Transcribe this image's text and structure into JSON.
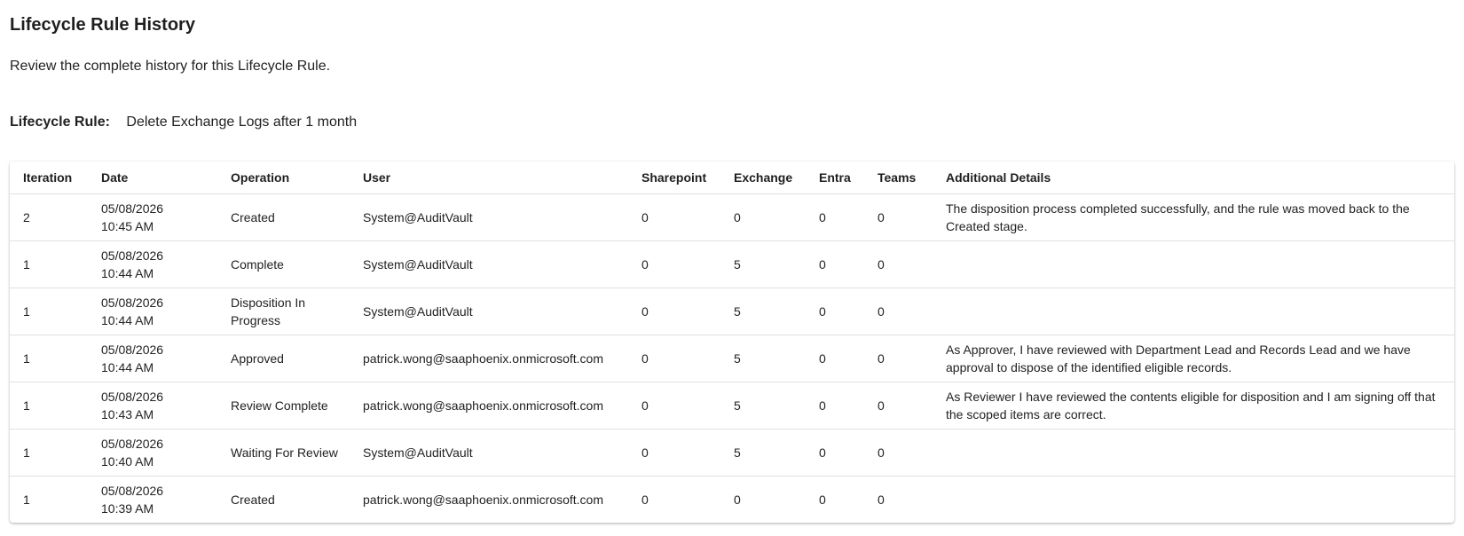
{
  "page": {
    "title": "Lifecycle Rule History",
    "subtitle": "Review the complete history for this Lifecycle Rule.",
    "rule_label": "Lifecycle Rule:",
    "rule_name": "Delete Exchange Logs after 1 month"
  },
  "table": {
    "headers": [
      "Iteration",
      "Date",
      "Operation",
      "User",
      "Sharepoint",
      "Exchange",
      "Entra",
      "Teams",
      "Additional Details"
    ],
    "rows": [
      {
        "iteration": "2",
        "date": "05/08/2026",
        "time": "10:45 AM",
        "operation": "Created",
        "user": "System@AuditVault",
        "sharepoint": "0",
        "exchange": "0",
        "entra": "0",
        "teams": "0",
        "details": "The disposition process completed successfully, and the rule was moved back to the Created stage."
      },
      {
        "iteration": "1",
        "date": "05/08/2026",
        "time": "10:44 AM",
        "operation": "Complete",
        "user": "System@AuditVault",
        "sharepoint": "0",
        "exchange": "5",
        "entra": "0",
        "teams": "0",
        "details": ""
      },
      {
        "iteration": "1",
        "date": "05/08/2026",
        "time": "10:44 AM",
        "operation": "Disposition In Progress",
        "user": "System@AuditVault",
        "sharepoint": "0",
        "exchange": "5",
        "entra": "0",
        "teams": "0",
        "details": ""
      },
      {
        "iteration": "1",
        "date": "05/08/2026",
        "time": "10:44 AM",
        "operation": "Approved",
        "user": "patrick.wong@saaphoenix.onmicrosoft.com",
        "sharepoint": "0",
        "exchange": "5",
        "entra": "0",
        "teams": "0",
        "details": "As Approver, I have reviewed with Department Lead and Records Lead and we have approval to dispose of the identified eligible records."
      },
      {
        "iteration": "1",
        "date": "05/08/2026",
        "time": "10:43 AM",
        "operation": "Review Complete",
        "user": "patrick.wong@saaphoenix.onmicrosoft.com",
        "sharepoint": "0",
        "exchange": "5",
        "entra": "0",
        "teams": "0",
        "details": "As Reviewer I have reviewed the contents eligible for disposition and I am signing off that the scoped items are correct."
      },
      {
        "iteration": "1",
        "date": "05/08/2026",
        "time": "10:40 AM",
        "operation": "Waiting For Review",
        "user": "System@AuditVault",
        "sharepoint": "0",
        "exchange": "5",
        "entra": "0",
        "teams": "0",
        "details": ""
      },
      {
        "iteration": "1",
        "date": "05/08/2026",
        "time": "10:39 AM",
        "operation": "Created",
        "user": "patrick.wong@saaphoenix.onmicrosoft.com",
        "sharepoint": "0",
        "exchange": "0",
        "entra": "0",
        "teams": "0",
        "details": ""
      }
    ]
  }
}
